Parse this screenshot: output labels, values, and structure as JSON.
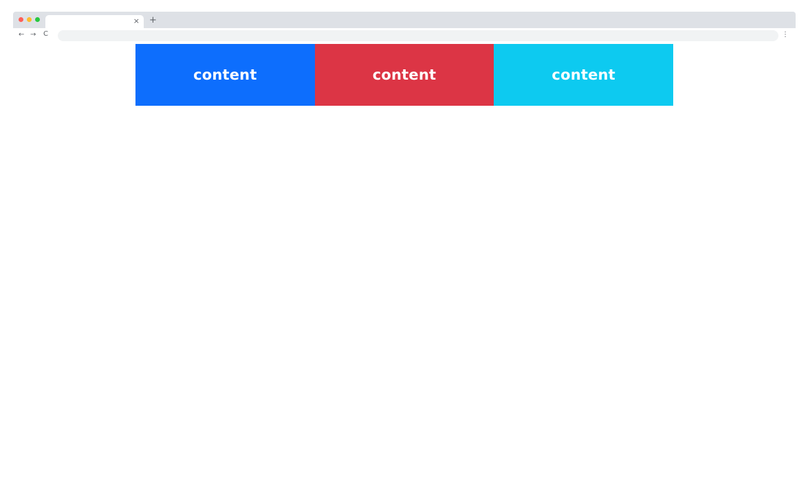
{
  "browser": {
    "tab": {
      "title": "",
      "close_glyph": "×"
    },
    "new_tab_glyph": "+",
    "toolbar": {
      "back_glyph": "←",
      "forward_glyph": "→",
      "reload_glyph": "C",
      "address": "",
      "menu_glyph": "⋮"
    },
    "traffic_light_colors": [
      "#ff5f57",
      "#febc2e",
      "#28c840"
    ]
  },
  "content": {
    "columns": [
      {
        "label": "content",
        "color": "#0d6efd"
      },
      {
        "label": "content",
        "color": "#dc3545"
      },
      {
        "label": "content",
        "color": "#0dcaf0"
      }
    ]
  }
}
